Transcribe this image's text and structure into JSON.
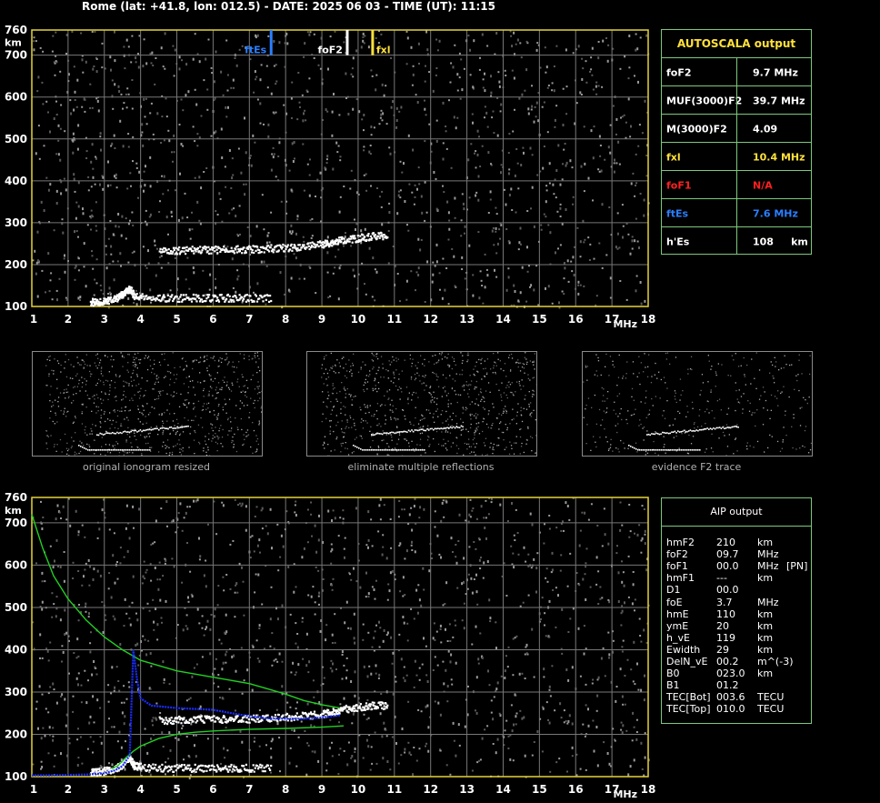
{
  "header": {
    "title": "Rome (lat: +41.8, lon: 012.5) - DATE: 2025 06 03 - TIME (UT): 11:15"
  },
  "colors": {
    "frame": "#e6d23a",
    "grid": "#777777",
    "green": "#22d022",
    "blue": "#1a2dff",
    "fte": "#2a7fff",
    "fxl": "#ffe13a",
    "foF1": "#ff2020"
  },
  "axes": {
    "y_unit": "km",
    "x_unit": "MHz",
    "yticks": [
      "760",
      "700",
      "600",
      "500",
      "400",
      "300",
      "200",
      "100"
    ],
    "xticks": [
      "1",
      "2",
      "3",
      "4",
      "5",
      "6",
      "7",
      "8",
      "9",
      "10",
      "11",
      "12",
      "13",
      "14",
      "15",
      "16",
      "17",
      "18"
    ]
  },
  "markers": [
    {
      "label": "ftEs",
      "freq": 7.6,
      "color": "#2a7fff"
    },
    {
      "label": "foF2",
      "freq": 9.7,
      "color": "#ffffff"
    },
    {
      "label": "fxl",
      "freq": 10.4,
      "color": "#ffe13a"
    }
  ],
  "autoscala": {
    "title": "AUTOSCALA output",
    "rows": [
      {
        "label": "foF2",
        "value": "9.7 MHz",
        "color": "#ffffff"
      },
      {
        "label": "MUF(3000)F2",
        "value": "39.7 MHz",
        "color": "#ffffff"
      },
      {
        "label": "M(3000)F2",
        "value": "4.09",
        "color": "#ffffff"
      },
      {
        "label": "fxl",
        "value": "10.4 MHz",
        "color": "#ffe13a"
      },
      {
        "label": "foF1",
        "value": "N/A",
        "color": "#ff2020"
      },
      {
        "label": "ftEs",
        "value": "7.6 MHz",
        "color": "#2a7fff"
      },
      {
        "label": "h'Es",
        "value": "108     km",
        "color": "#ffffff"
      }
    ]
  },
  "thumbnails": [
    {
      "caption": "original ionogram resized"
    },
    {
      "caption": "eliminate multiple reflections"
    },
    {
      "caption": "evidence F2 trace"
    }
  ],
  "aip": {
    "title": "AIP output",
    "rows": [
      {
        "name": "hmF2",
        "value": "210",
        "unit": "km",
        "extra": ""
      },
      {
        "name": "foF2",
        "value": "09.7",
        "unit": "MHz",
        "extra": ""
      },
      {
        "name": "foF1",
        "value": "00.0",
        "unit": "MHz",
        "extra": "[PN]"
      },
      {
        "name": "hmF1",
        "value": "---",
        "unit": "km",
        "extra": ""
      },
      {
        "name": "D1",
        "value": "00.0",
        "unit": "",
        "extra": ""
      },
      {
        "name": "foE",
        "value": "3.7",
        "unit": "MHz",
        "extra": ""
      },
      {
        "name": "hmE",
        "value": "110",
        "unit": "km",
        "extra": ""
      },
      {
        "name": "ymE",
        "value": "20",
        "unit": "km",
        "extra": ""
      },
      {
        "name": "h_vE",
        "value": "119",
        "unit": "km",
        "extra": ""
      },
      {
        "name": "Ewidth",
        "value": "29",
        "unit": "km",
        "extra": ""
      },
      {
        "name": "DelN_vE",
        "value": "00.2",
        "unit": "m^(-3)",
        "extra": ""
      },
      {
        "name": "B0",
        "value": "023.0",
        "unit": "km",
        "extra": ""
      },
      {
        "name": "B1",
        "value": "01.2",
        "unit": "",
        "extra": ""
      },
      {
        "name": "TEC[Bot]",
        "value": "003.6",
        "unit": "TECU",
        "extra": ""
      },
      {
        "name": "TEC[Top]",
        "value": "010.0",
        "unit": "TECU",
        "extra": ""
      }
    ]
  },
  "chart_data": [
    {
      "type": "scatter",
      "xlabel": "MHz",
      "ylabel": "km",
      "xlim": [
        1,
        18
      ],
      "ylim": [
        100,
        760
      ],
      "series": [
        {
          "points": [
            [
              2.6,
              112
            ],
            [
              2.8,
              113
            ],
            [
              3.0,
              115
            ],
            [
              3.2,
              118
            ],
            [
              3.4,
              125
            ],
            [
              3.5,
              132
            ],
            [
              3.6,
              140
            ],
            [
              3.7,
              143
            ],
            [
              3.8,
              128
            ],
            [
              4.0,
              125
            ],
            [
              4.5,
              122
            ],
            [
              5.0,
              122
            ],
            [
              5.5,
              122
            ],
            [
              6.0,
              122
            ],
            [
              6.5,
              122
            ],
            [
              7.0,
              122
            ],
            [
              7.6,
              122
            ]
          ]
        },
        {
          "points": [
            [
              4.5,
              235
            ],
            [
              5.0,
              236
            ],
            [
              5.5,
              237
            ],
            [
              6.0,
              237
            ],
            [
              6.5,
              238
            ],
            [
              7.0,
              238
            ],
            [
              7.5,
              240
            ],
            [
              8.0,
              242
            ],
            [
              8.5,
              246
            ],
            [
              9.0,
              250
            ],
            [
              9.3,
              255
            ],
            [
              9.6,
              262
            ],
            [
              10.0,
              265
            ],
            [
              10.4,
              270
            ],
            [
              10.8,
              270
            ]
          ]
        }
      ]
    },
    {
      "type": "line",
      "xlabel": "MHz",
      "ylabel": "km",
      "xlim": [
        1,
        18
      ],
      "ylim": [
        100,
        760
      ],
      "series": [
        {
          "points": [
            [
              1.0,
              720
            ],
            [
              1.3,
              640
            ],
            [
              1.6,
              575
            ],
            [
              2.0,
              520
            ],
            [
              2.5,
              470
            ],
            [
              3.0,
              430
            ],
            [
              3.5,
              400
            ],
            [
              4.0,
              375
            ],
            [
              5.0,
              350
            ],
            [
              6.0,
              335
            ],
            [
              7.0,
              320
            ],
            [
              7.6,
              305
            ],
            [
              8.0,
              295
            ],
            [
              8.5,
              280
            ],
            [
              9.0,
              270
            ],
            [
              9.5,
              262
            ]
          ]
        },
        {
          "points": [
            [
              3.2,
              118
            ],
            [
              3.4,
              128
            ],
            [
              3.6,
              145
            ],
            [
              3.8,
              160
            ],
            [
              4.0,
              172
            ],
            [
              4.5,
              190
            ],
            [
              5.0,
              200
            ],
            [
              5.5,
              205
            ],
            [
              6.0,
              208
            ],
            [
              7.0,
              212
            ],
            [
              8.0,
              214
            ],
            [
              9.0,
              217
            ],
            [
              9.6,
              220
            ]
          ]
        },
        {
          "points": [
            [
              1.0,
              103
            ],
            [
              1.5,
              103
            ],
            [
              2.0,
              104
            ],
            [
              2.5,
              105
            ],
            [
              3.0,
              108
            ],
            [
              3.3,
              115
            ],
            [
              3.5,
              125
            ],
            [
              3.7,
              150
            ],
            [
              3.8,
              400
            ],
            [
              3.9,
              330
            ],
            [
              4.0,
              285
            ],
            [
              4.3,
              268
            ],
            [
              5.0,
              262
            ],
            [
              6.0,
              258
            ],
            [
              6.5,
              250
            ],
            [
              7.0,
              243
            ],
            [
              7.5,
              238
            ],
            [
              8.0,
              237
            ],
            [
              8.5,
              237
            ],
            [
              9.0,
              240
            ],
            [
              9.5,
              245
            ]
          ]
        }
      ]
    }
  ]
}
